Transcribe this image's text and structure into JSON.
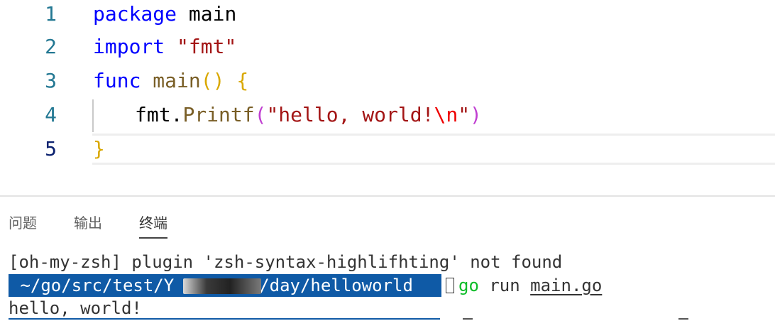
{
  "editor": {
    "lines": [
      {
        "num": "1",
        "tokens": [
          "package",
          " main"
        ]
      },
      {
        "num": "2",
        "tokens": [
          "import",
          " ",
          "\"fmt\""
        ]
      },
      {
        "num": "3",
        "tokens": [
          "func",
          " ",
          "main",
          "(",
          ")",
          " ",
          "{"
        ]
      },
      {
        "num": "4",
        "tokens": [
          "fmt.",
          "Printf",
          "(",
          "\"hello, world!",
          "\\n",
          "\"",
          ")"
        ]
      },
      {
        "num": "5",
        "tokens": [
          "}"
        ]
      }
    ]
  },
  "panel": {
    "tabs": [
      "问题",
      "输出",
      "终端"
    ],
    "active_tab": "终端"
  },
  "terminal": {
    "line1": "[oh-my-zsh] plugin 'zsh-syntax-highlifhting' not found",
    "prompt_path_start": " ~/go/src/test/Y",
    "prompt_path_end": "/day/helloworld",
    "cmd_go": "go",
    "cmd_run": " run ",
    "cmd_file": "main.go",
    "output": "hello, world!"
  },
  "colors": {
    "keyword": "#0000ff",
    "function": "#795e26",
    "string": "#a31515",
    "prompt_bg": "#0f5aa6",
    "go_cmd": "#0dbc28"
  }
}
